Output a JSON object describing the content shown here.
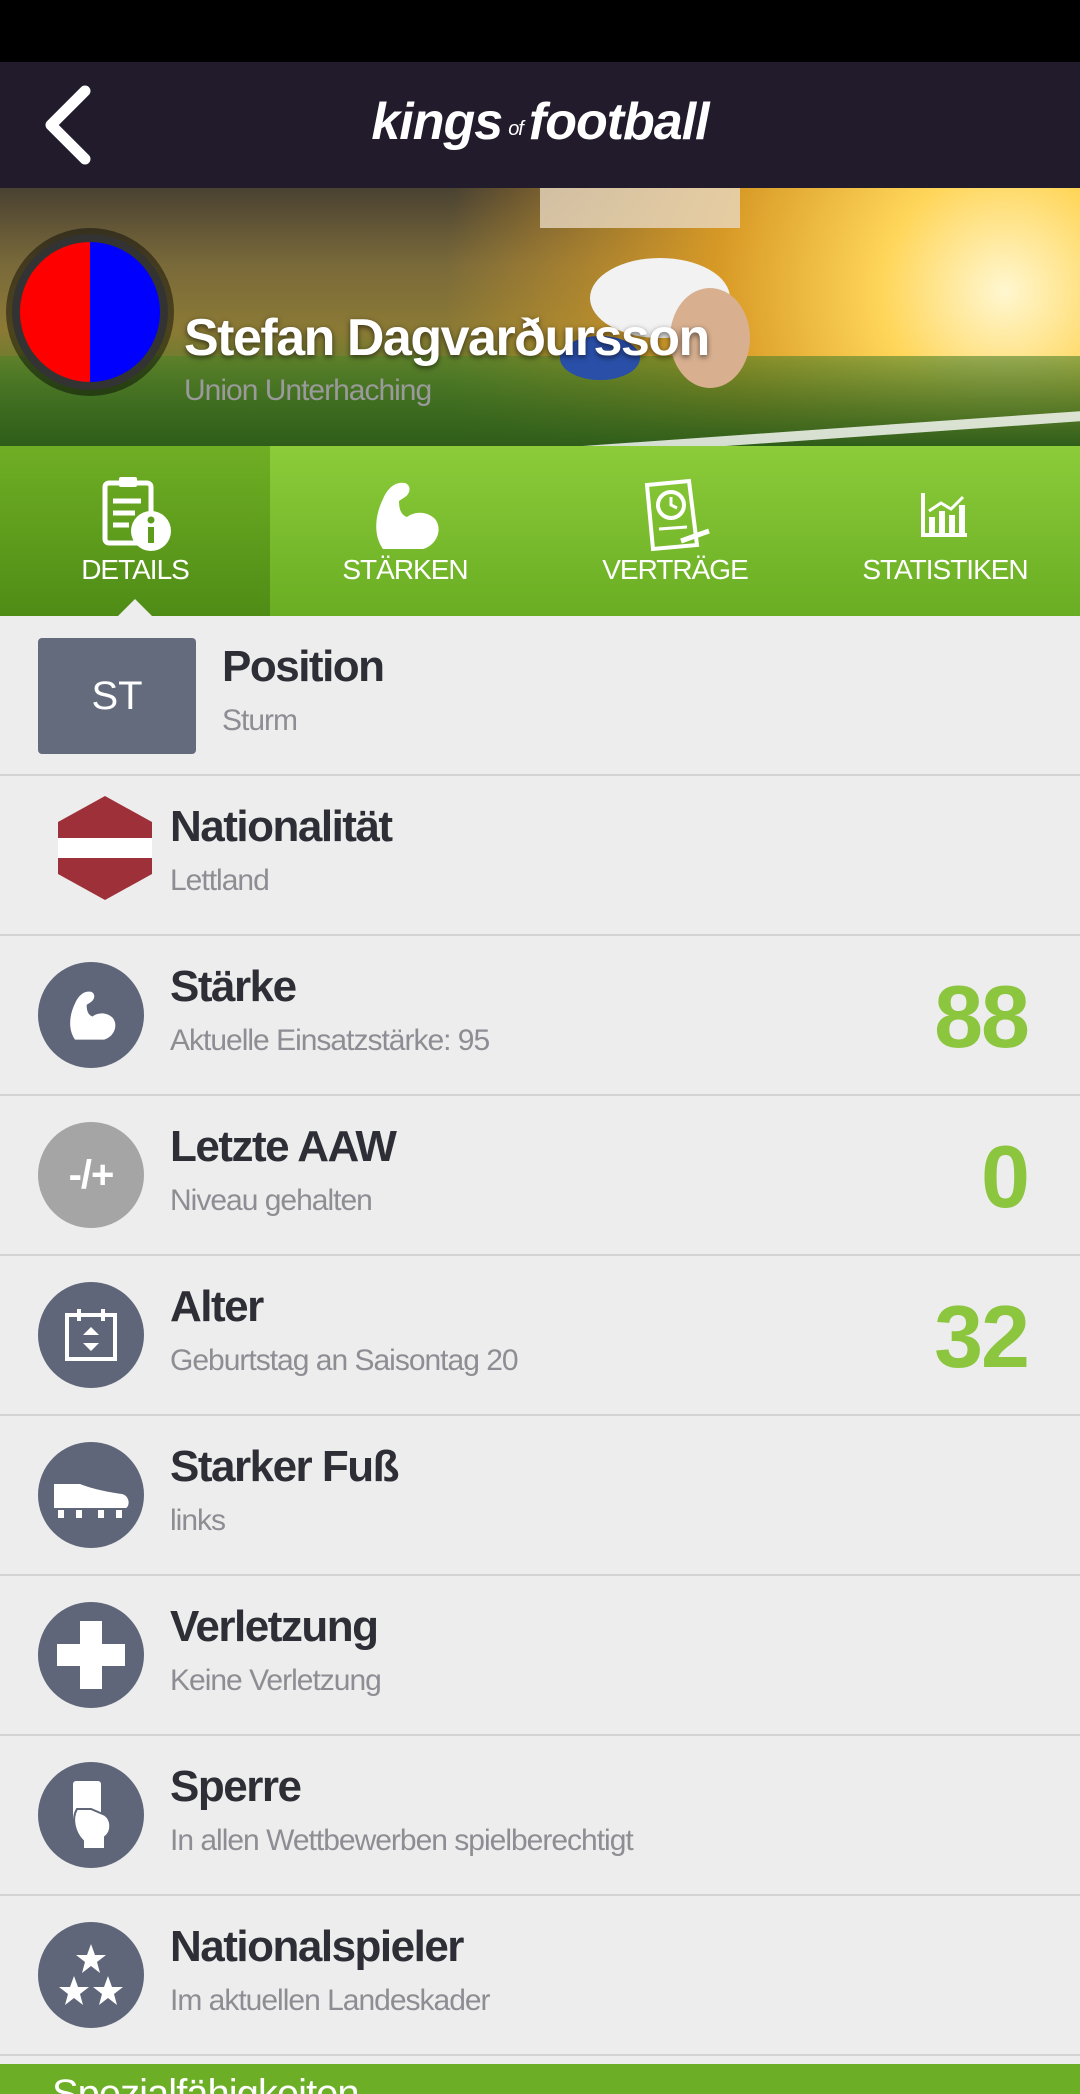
{
  "header": {
    "logo_part1": "kings",
    "logo_part2": "of",
    "logo_part3": "football"
  },
  "player": {
    "name": "Stefan Dagvarðursson",
    "club": "Union Unterhaching",
    "club_colors": [
      "#ff0000",
      "#0000ff"
    ]
  },
  "tabs": [
    {
      "label": "DETAILS",
      "icon": "details-info-icon",
      "active": true
    },
    {
      "label": "STÄRKEN",
      "icon": "flexed-arm-icon",
      "active": false
    },
    {
      "label": "VERTRÄGE",
      "icon": "contract-clock-icon",
      "active": false
    },
    {
      "label": "STATISTIKEN",
      "icon": "bar-chart-icon",
      "active": false
    }
  ],
  "rows": {
    "position": {
      "badge": "ST",
      "title": "Position",
      "sub": "Sturm"
    },
    "nationality": {
      "title": "Nationalität",
      "sub": "Lettland",
      "flag_colors": [
        "#9e3039",
        "#ffffff"
      ]
    },
    "strength": {
      "title": "Stärke",
      "sub": "Aktuelle Einsatzstärke: 95",
      "value": "88",
      "icon": "flexed-arm-icon"
    },
    "aaw": {
      "title": "Letzte AAW",
      "sub": "Niveau gehalten",
      "value": "0",
      "icon_text": "-/+"
    },
    "age": {
      "title": "Alter",
      "sub": "Geburtstag an Saisontag 20",
      "value": "32",
      "icon": "calendar-icon"
    },
    "foot": {
      "title": "Starker Fuß",
      "sub": "links",
      "icon": "football-boot-icon"
    },
    "injury": {
      "title": "Verletzung",
      "sub": "Keine Verletzung",
      "icon": "medical-cross-icon"
    },
    "ban": {
      "title": "Sperre",
      "sub": "In allen Wettbewerben spielberechtigt",
      "icon": "referee-card-icon"
    },
    "national": {
      "title": "Nationalspieler",
      "sub": "Im aktuellen Landeskader",
      "icon": "stars-icon"
    }
  },
  "footer": {
    "label": "Spezialfähigkeiten"
  },
  "colors": {
    "accent_green": "#8cc63f",
    "icon_bg": "#5f6679",
    "topbar": "#221b2c"
  }
}
